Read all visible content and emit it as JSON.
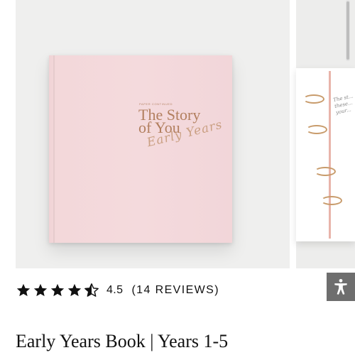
{
  "gallery": {
    "book_cover": {
      "brand": "PAPER CONTINUED",
      "title_line1": "The Story",
      "title_line2": "of You",
      "script_text": "Early Years"
    },
    "next_slide_note": "The st... these... your..."
  },
  "rating": {
    "stars": 4.5,
    "max_stars": 5,
    "value": "4.5",
    "reviews_text": "(14 REVIEWS)",
    "star_color": "#111111"
  },
  "accessibility": {
    "icon": "accessibility-person-icon",
    "background_color": "#6e6e6e"
  },
  "product": {
    "title": "Early Years Book | Years 1-5"
  }
}
